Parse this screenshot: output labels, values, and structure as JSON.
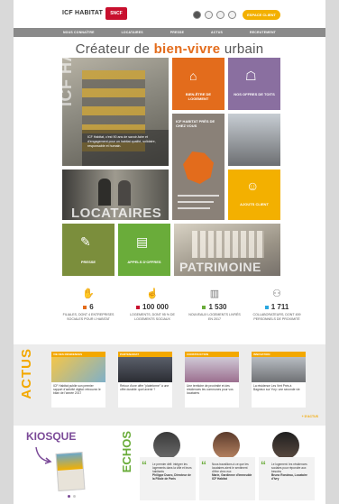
{
  "header": {
    "logo": "ICF HABITAT",
    "logo_badge": "SNCF",
    "space_button": "ESPACE CLIENT"
  },
  "nav": {
    "items": [
      "NOUS CONNAÎTRE",
      "LOCATAIRES",
      "PRESSE",
      "ACTUS",
      "RECRUTEMENT"
    ]
  },
  "hero": {
    "title_start": "Créateur de ",
    "title_highlight": "bien-vivre",
    "title_end": " urbain"
  },
  "tiles": {
    "biens": "BIEN-ÊTRE DE LOGEMENT",
    "offres": "NOS OFFRES DE TOITS",
    "icf_text": "ICF Habitat, c'est 90 ans de savoir-faire et d'engagement pour un habitat qualité, solidaire, responsable et humain.",
    "map_heading": "ICF HABITAT PRÈS DE CHEZ VOUS",
    "locataires": "LOCATAIRES",
    "presse": "PRESSE",
    "appels": "APPELS D'OFFRES",
    "patrimoine": "PATRIMOINE",
    "ajouts": "AJOUTS CLIENT"
  },
  "stats": [
    {
      "value": "6",
      "label": "FILIALES, DONT 4 ENTREPRISES SOCIALES POUR L'HABITAT",
      "color": "#e36c1c",
      "icon": "hands-icon"
    },
    {
      "value": "100 000",
      "label": "LOGEMENTS, DONT 95 % DE LOGEMENTS SOCIAUX",
      "color": "#c8102e",
      "icon": "hand-key-icon"
    },
    {
      "value": "1 530",
      "label": "NOUVEAUX LOGEMENTS LIVRÉS EN 2017",
      "color": "#6aac3a",
      "icon": "building-icon"
    },
    {
      "value": "1 711",
      "label": "COLLABORATEURS, DONT 459 PERSONNELS DE PROXIMITÉ",
      "color": "#2aa7df",
      "icon": "people-icon"
    }
  ],
  "actus": {
    "title": "ACTUS",
    "more": "+ D'ACTUS",
    "cards": [
      {
        "category": "VIE DES RÉSIDENCES",
        "text": "ICF Habitat publie son premier rapport d'activité digital: retrouvez le bilan de l'année 2017"
      },
      {
        "category": "PARTENARIAT",
        "text": "Retour d'une offre \"plateforme\" à une offre durable: quel avenir ?"
      },
      {
        "category": "CONSTRUCTION",
        "text": "Une territoire de proximité et des résidences les communes pour vos locataires"
      },
      {
        "category": "INNOVATION",
        "text": "La résidence Les Vert Prés à Bagneux sur Yvry: une seconde vie"
      }
    ]
  },
  "kiosque": {
    "title": "KIOSQUE"
  },
  "echos": {
    "title": "ECHOS",
    "items": [
      {
        "text": "Le premier défi: intégrer les logements dans la ville et leurs habitants",
        "author": "Philippe Ducro, Directeur de la Filiale de Paris"
      },
      {
        "text": "Nous travaillons à ce que les locataires aient le sentiment d'être chez eux",
        "author": "Marie, Gardienne d'immeuble ICF Habitat"
      },
      {
        "text": "Le logement: les résidences sociales pour répondre aux besoins",
        "author": "Bruno Rondeau, Locataire d'Ivry"
      }
    ]
  },
  "colors": {
    "orange": "#e36c1c",
    "purple": "#8a6fa0",
    "green": "#6aac3a",
    "gold": "#f3b000",
    "grey": "#8a8a8a"
  }
}
